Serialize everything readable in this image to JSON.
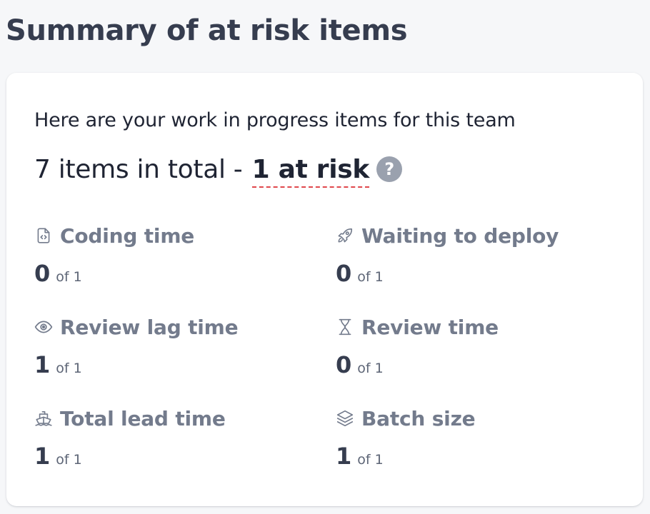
{
  "page": {
    "title": "Summary of at risk items"
  },
  "summary": {
    "intro": "Here are your work in progress items for this team",
    "total_text": "7 items in total - ",
    "at_risk_text": "1 at risk",
    "help_glyph": "?"
  },
  "metrics": [
    {
      "label": "Coding time",
      "icon": "code-file-icon",
      "count": "0",
      "of_text": "of 1"
    },
    {
      "label": "Waiting to deploy",
      "icon": "rocket-icon",
      "count": "0",
      "of_text": "of 1"
    },
    {
      "label": "Review lag time",
      "icon": "eye-icon",
      "count": "1",
      "of_text": "of 1"
    },
    {
      "label": "Review time",
      "icon": "hourglass-icon",
      "count": "0",
      "of_text": "of 1"
    },
    {
      "label": "Total lead time",
      "icon": "ship-icon",
      "count": "1",
      "of_text": "of 1"
    },
    {
      "label": "Batch size",
      "icon": "layers-icon",
      "count": "1",
      "of_text": "of 1"
    }
  ],
  "colors": {
    "background": "#f6f7f9",
    "card": "#ffffff",
    "text_primary": "#1f2433",
    "text_muted": "#737b8c",
    "risk_underline": "#e0474c",
    "help_badge": "#9aa1ae"
  }
}
